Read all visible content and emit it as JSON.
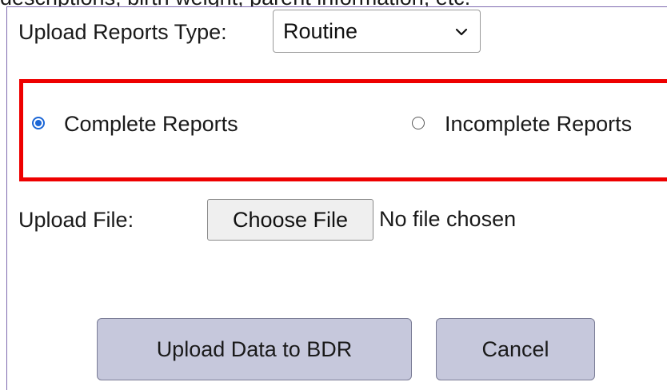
{
  "top_text": "descriptions, birth weight, parent information, etc.",
  "upload_type": {
    "label": "Upload Reports Type:",
    "selected": "Routine"
  },
  "report_options": [
    {
      "label": "Complete Reports",
      "checked": true
    },
    {
      "label": "Incomplete Reports",
      "checked": false
    }
  ],
  "upload_file": {
    "label": "Upload File:",
    "button_label": "Choose File",
    "status": "No file chosen"
  },
  "actions": {
    "upload_label": "Upload Data to BDR",
    "cancel_label": "Cancel"
  },
  "colors": {
    "highlight_border": "#ee0000",
    "radio_accent": "#1b66d6",
    "button_bg": "#c6c8dc",
    "panel_border": "#7f6ab0"
  }
}
